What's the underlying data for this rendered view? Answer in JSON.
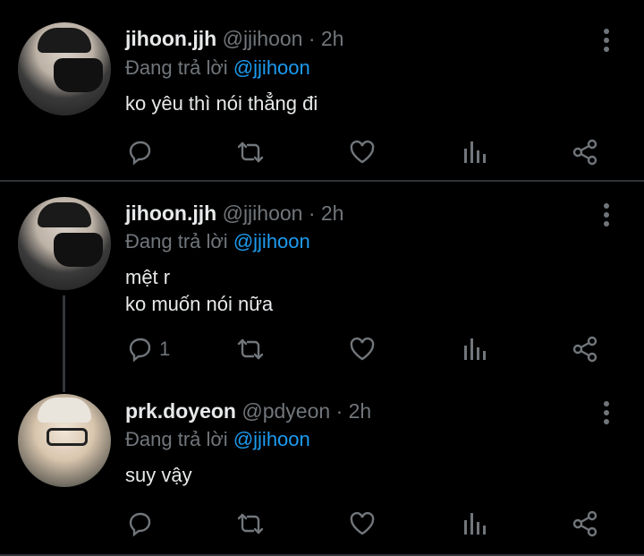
{
  "tweets": [
    {
      "name": "jihoon.jjh",
      "handle": "@jjihoon",
      "sep": "·",
      "time": "2h",
      "reply_prefix": "Đang trả lời",
      "reply_to": "@jjihoon",
      "lines": [
        "ko yêu thì nói thẳng đi"
      ],
      "reply_count": ""
    },
    {
      "name": "jihoon.jjh",
      "handle": "@jjihoon",
      "sep": "·",
      "time": "2h",
      "reply_prefix": "Đang trả lời",
      "reply_to": "@jjihoon",
      "lines": [
        "mệt r",
        "ko muốn nói nữa"
      ],
      "reply_count": "1"
    },
    {
      "name": "prk.doyeon",
      "handle": "@pdyeon",
      "sep": "·",
      "time": "2h",
      "reply_prefix": "Đang trả lời",
      "reply_to": "@jjihoon",
      "lines": [
        "suy vậy"
      ],
      "reply_count": ""
    }
  ],
  "icons": {
    "reply": "reply-icon",
    "retweet": "retweet-icon",
    "like": "heart-icon",
    "views": "views-icon",
    "share": "share-icon",
    "more": "more-vertical-icon"
  },
  "colors": {
    "background": "#000000",
    "text": "#e7e9ea",
    "muted": "#71767b",
    "link": "#1d9bf0",
    "divider": "#2f3336"
  }
}
